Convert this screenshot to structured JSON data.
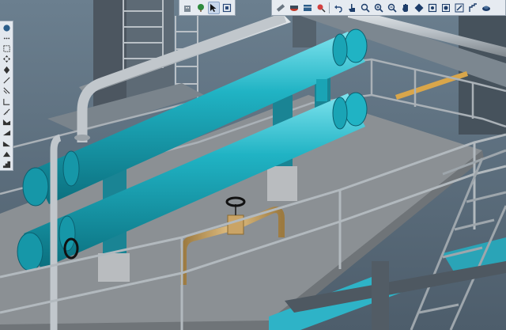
{
  "viewer": {
    "colors": {
      "background": "#5c6e7e",
      "floor": "#8c9094",
      "pipe": "#1fa7b8",
      "valve_pipe": "#c8a062",
      "railing": "#a9b0b6",
      "water": "#2eb3c7"
    }
  },
  "toolbar_left": {
    "buttons": [
      {
        "icon": "building-icon",
        "active": false
      },
      {
        "icon": "tree-icon",
        "active": false
      },
      {
        "icon": "select-cursor-icon",
        "active": true
      },
      {
        "icon": "zoom-window-icon",
        "active": false
      }
    ]
  },
  "toolbar_right": {
    "buttons": [
      {
        "icon": "measure-icon"
      },
      {
        "icon": "section-icon"
      },
      {
        "icon": "layers-icon"
      },
      {
        "icon": "clipping-icon"
      },
      {
        "icon": "undo-icon"
      },
      {
        "icon": "hand-pointer-icon"
      },
      {
        "icon": "zoom-icon"
      },
      {
        "icon": "zoom-in-icon"
      },
      {
        "icon": "zoom-out-icon"
      },
      {
        "icon": "pan-hand-icon"
      },
      {
        "icon": "orbit-icon"
      },
      {
        "icon": "fit-view-icon"
      },
      {
        "icon": "view-cube-icon"
      },
      {
        "icon": "top-view-icon"
      },
      {
        "icon": "walk-icon"
      },
      {
        "icon": "camera-icon"
      }
    ]
  },
  "palette": {
    "buttons": [
      {
        "icon": "sphere-icon"
      },
      {
        "icon": "dots-icon"
      },
      {
        "icon": "frame-icon"
      },
      {
        "icon": "move-icon"
      },
      {
        "icon": "rotate-icon"
      },
      {
        "icon": "line-icon"
      },
      {
        "icon": "diagonal-icon"
      },
      {
        "icon": "angle-icon"
      },
      {
        "icon": "ruler-icon"
      },
      {
        "icon": "profile-icon"
      },
      {
        "icon": "slope-icon"
      },
      {
        "icon": "corner-icon"
      },
      {
        "icon": "wedge-icon"
      },
      {
        "icon": "stairs-icon"
      }
    ]
  }
}
